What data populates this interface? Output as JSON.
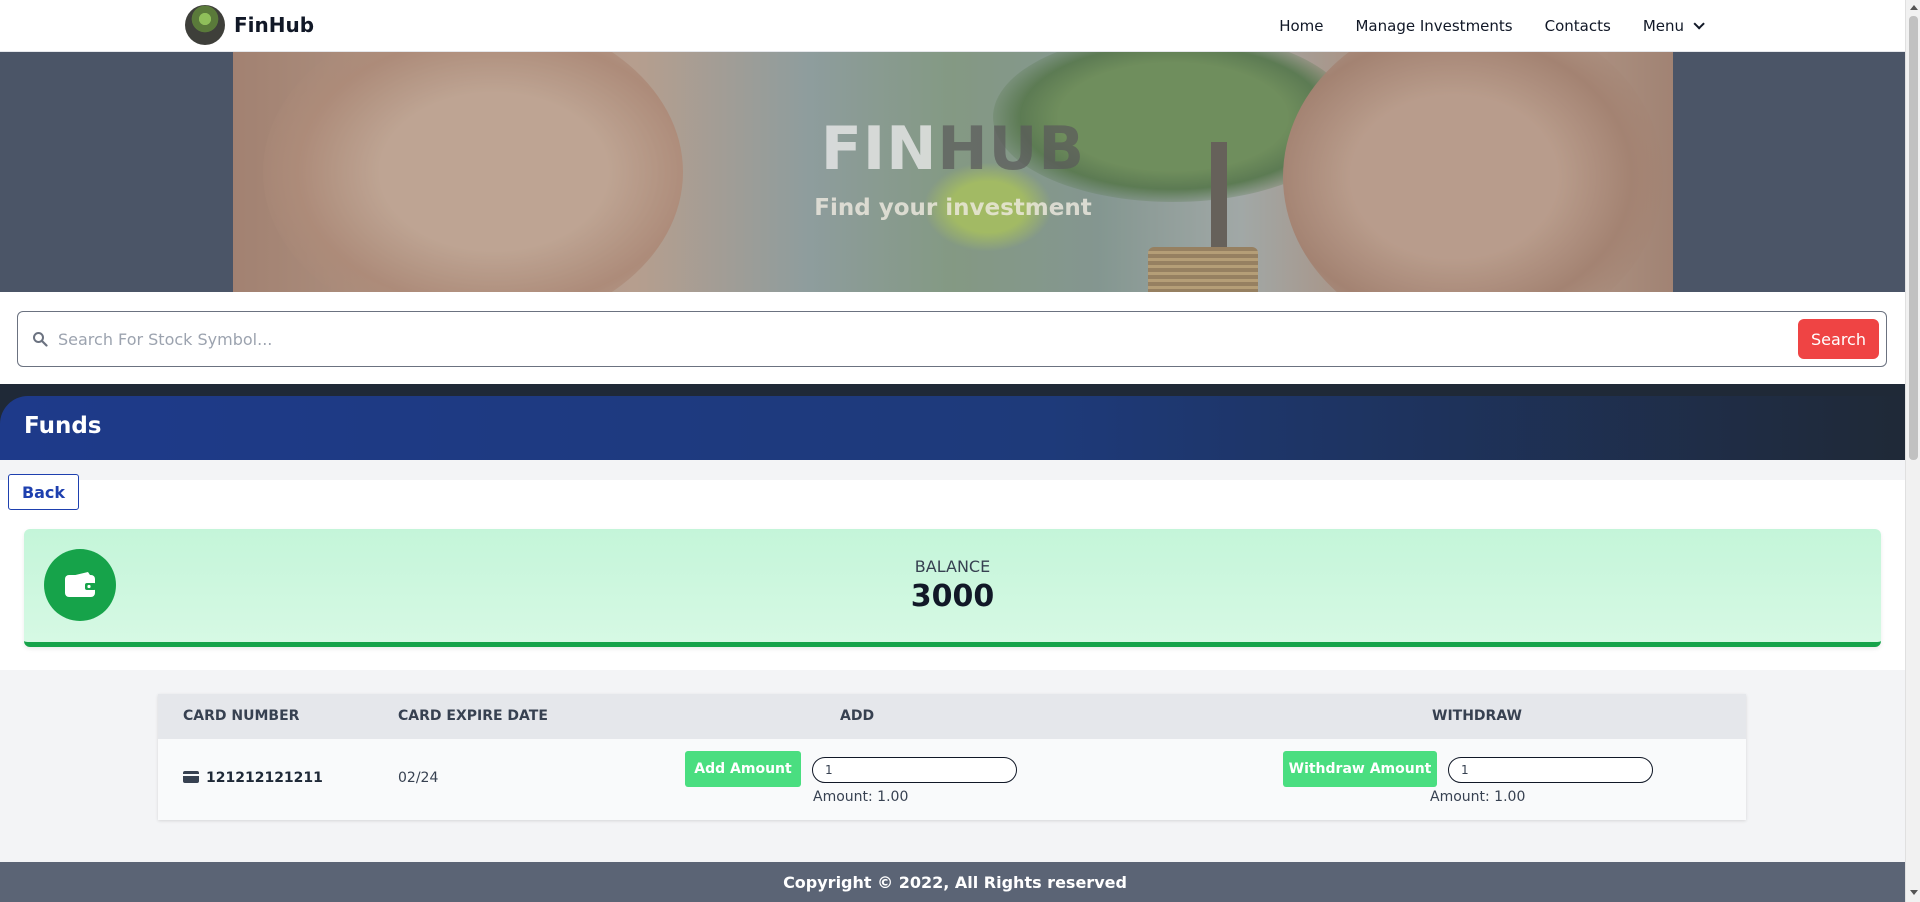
{
  "navbar": {
    "brand": "FinHub",
    "links": [
      "Home",
      "Manage Investments",
      "Contacts"
    ],
    "menu_label": "Menu"
  },
  "hero": {
    "title_part1": "FIN",
    "title_part2": "HUB",
    "subtitle": "Find your investment"
  },
  "search": {
    "placeholder": "Search For Stock Symbol...",
    "button_label": "Search"
  },
  "funds": {
    "title": "Funds",
    "back_label": "Back"
  },
  "balance": {
    "label": "BALANCE",
    "value": "3000"
  },
  "table": {
    "headers": {
      "card_number": "CARD NUMBER",
      "expire_date": "CARD EXPIRE DATE",
      "add": "ADD",
      "withdraw": "WITHDRAW"
    },
    "rows": [
      {
        "card_number": "121212121211",
        "expire_date": "02/24",
        "add_button": "Add Amount",
        "add_value": "1",
        "add_note": "Amount: 1.00",
        "withdraw_button": "Withdraw Amount",
        "withdraw_value": "1",
        "withdraw_note": "Amount: 1.00"
      }
    ]
  },
  "footer": {
    "text": "Copyright © 2022, All Rights reserved"
  },
  "colors": {
    "accent_red": "#ef4444",
    "funds_blue": "#1e3a8a",
    "balance_green": "#16a34a",
    "button_green": "#4ade80"
  },
  "icons": [
    "search-icon",
    "chevron-down-icon",
    "wallet-icon",
    "credit-card-icon"
  ]
}
